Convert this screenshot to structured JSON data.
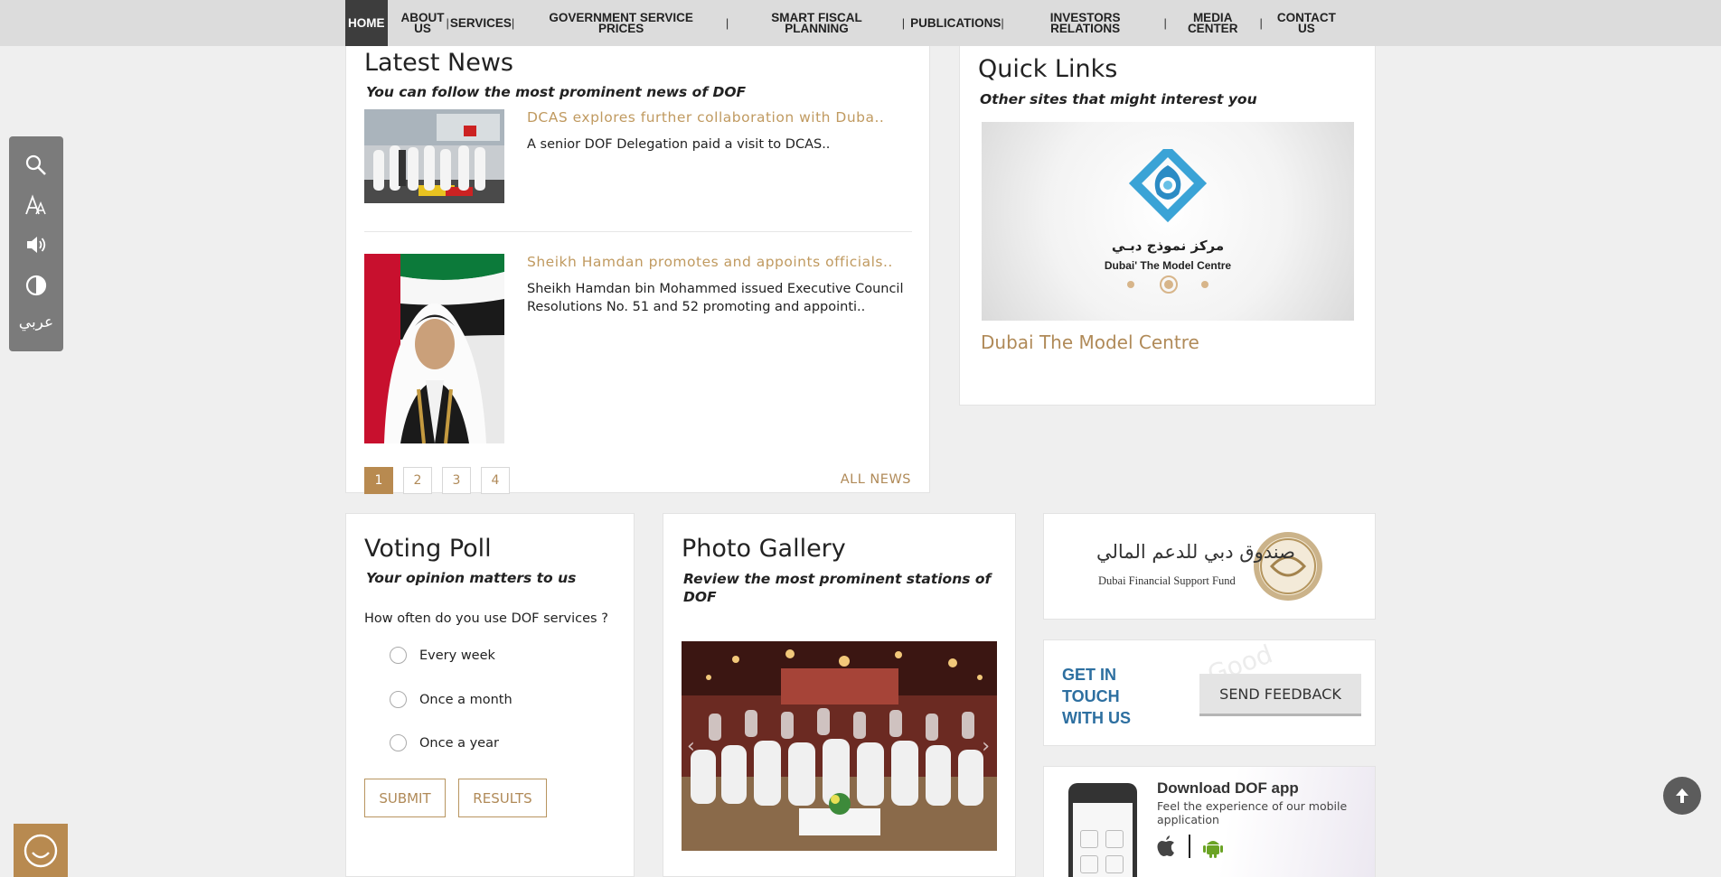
{
  "nav": {
    "items": [
      {
        "label": "HOME",
        "lines": [
          "HOME"
        ]
      },
      {
        "label": "ABOUT US",
        "lines": [
          "ABOUT",
          "US"
        ]
      },
      {
        "label": "SERVICES",
        "lines": [
          "SERVICES"
        ]
      },
      {
        "label": "GOVERNMENT SERVICE PRICES",
        "lines": [
          "GOVERNMENT SERVICE",
          "PRICES"
        ]
      },
      {
        "label": "SMART FISCAL PLANNING",
        "lines": [
          "SMART FISCAL",
          "PLANNING"
        ]
      },
      {
        "label": "PUBLICATIONS",
        "lines": [
          "PUBLICATIONS"
        ]
      },
      {
        "label": "INVESTORS RELATIONS",
        "lines": [
          "INVESTORS",
          "RELATIONS"
        ]
      },
      {
        "label": "MEDIA CENTER",
        "lines": [
          "MEDIA",
          "CENTER"
        ]
      },
      {
        "label": "CONTACT US",
        "lines": [
          "CONTACT",
          "US"
        ]
      }
    ],
    "separator": "|"
  },
  "tools": {
    "search": "search-icon",
    "text_size": "text-size-icon",
    "audio": "speaker-icon",
    "contrast": "contrast-icon",
    "language_label": "عربي"
  },
  "latest_news": {
    "title": "Latest News",
    "subtitle": "You can follow the most prominent news of DOF",
    "items": [
      {
        "title": "DCAS explores further collaboration with Duba..",
        "desc_lines": [
          "A senior DOF Delegation paid a visit to DCAS.."
        ]
      },
      {
        "title": "Sheikh Hamdan promotes and appoints officials..",
        "desc_lines": [
          "Sheikh Hamdan bin Mohammed issued Executive Council",
          "Resolutions No. 51 and 52 promoting and appointi.."
        ]
      }
    ],
    "pages": [
      "1",
      "2",
      "3",
      "4"
    ],
    "active_page": "1",
    "all_news_label": "ALL NEWS"
  },
  "quick_links": {
    "title": "Quick Links",
    "subtitle": "Other sites that might interest you",
    "logo_arabic": "مركز نموذج دبـي",
    "logo_english": "Dubai' The Model Centre",
    "link_label": "Dubai The Model Centre"
  },
  "voting_poll": {
    "title": "Voting Poll",
    "subtitle": "Your opinion matters to us",
    "question": "How often do you use DOF services ?",
    "options": [
      "Every week",
      "Once a month",
      "Once a year"
    ],
    "submit_label": "SUBMIT",
    "results_label": "RESULTS"
  },
  "photo_gallery": {
    "title": "Photo Gallery",
    "subtitle_lines": [
      "Review the most prominent stations of",
      "DOF"
    ]
  },
  "support_fund": {
    "arabic": "صندوق دبي للدعم المالي",
    "english": "Dubai Financial Support Fund"
  },
  "contact": {
    "lines": [
      "GET IN",
      "TOUCH",
      "WITH US"
    ],
    "button_label": "SEND FEEDBACK"
  },
  "app": {
    "title": "Download DOF app",
    "desc_lines": [
      "Feel the experience of our mobile",
      "application"
    ],
    "apple": "apple-icon",
    "android": "android-icon"
  },
  "colors": {
    "accent": "#b88a50",
    "link_gold": "#c09a60",
    "nav_bg": "#dcdcdc",
    "nav_active": "#3d3d3d",
    "contact_blue": "#2d6fa0"
  }
}
